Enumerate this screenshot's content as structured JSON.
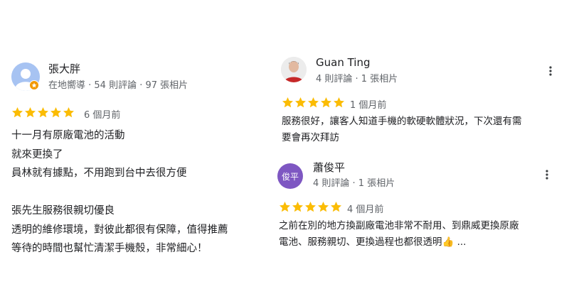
{
  "colors": {
    "star": "#fbbc04",
    "meta": "#5f6368",
    "text": "#202124",
    "avatar_purple": "#7e57c2"
  },
  "reviews": [
    {
      "name": "張大胖",
      "meta": "在地嚮導 · 54 則評論 · 97 張相片",
      "rating": 5,
      "time": "6 個月前",
      "lines": [
        "十一月有原廠電池的活動",
        "就來更換了",
        "員林就有據點，不用跑到台中去很方便",
        "",
        "張先生服務很親切優良",
        "透明的維修環境，對彼此都很有保障，值得推薦",
        "等待的時間也幫忙清潔手機殼，非常細心！"
      ]
    },
    {
      "name": "Guan Ting",
      "meta": "4 則評論 · 1 張相片",
      "rating": 5,
      "time": "1 個月前",
      "lines": [
        "服務很好，讓客人知道手機的軟硬軟體狀況，下次還有需",
        "要會再次拜訪"
      ]
    },
    {
      "name": "蕭俊平",
      "avatar_text": "俊平",
      "meta": "4 則評論 · 1 張相片",
      "rating": 5,
      "time": "4 個月前",
      "lines": [
        "之前在別的地方換副廠電池非常不耐用、到鼎威更換原廠",
        "電池、服務親切、更換過程也都很透明👍 ..."
      ]
    }
  ]
}
